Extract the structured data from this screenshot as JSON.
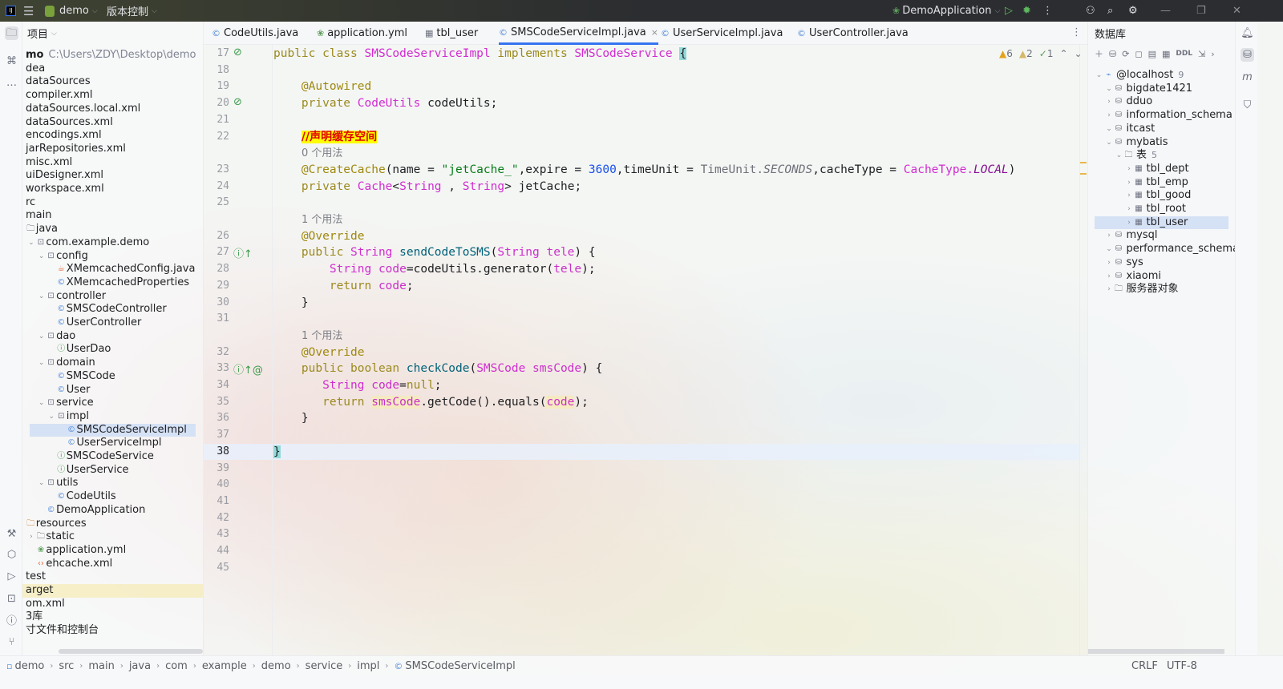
{
  "titlebar": {
    "project": "demo",
    "vcs": "版本控制",
    "run_config": "DemoApplication"
  },
  "project_panel": {
    "title": "项目",
    "items": [
      {
        "label": "mo",
        "level": 0,
        "path": "C:\\Users\\ZDY\\Desktop\\demo",
        "bold": true
      },
      {
        "label": "dea",
        "level": 0
      },
      {
        "label": "dataSources",
        "level": 0
      },
      {
        "label": "compiler.xml",
        "level": 0
      },
      {
        "label": "dataSources.local.xml",
        "level": 0
      },
      {
        "label": "dataSources.xml",
        "level": 0
      },
      {
        "label": "encodings.xml",
        "level": 0
      },
      {
        "label": "jarRepositories.xml",
        "level": 0
      },
      {
        "label": "misc.xml",
        "level": 0
      },
      {
        "label": "uiDesigner.xml",
        "level": 0
      },
      {
        "label": "workspace.xml",
        "level": 0
      },
      {
        "label": "rc",
        "level": 0
      },
      {
        "label": "main",
        "level": 0
      },
      {
        "label": "java",
        "level": 1,
        "icon": "folder"
      },
      {
        "label": "com.example.demo",
        "level": 2,
        "icon": "package",
        "open": true
      },
      {
        "label": "config",
        "level": 3,
        "icon": "package",
        "open": true
      },
      {
        "label": "XMemcachedConfig.java",
        "level": 4,
        "icon": "java-file"
      },
      {
        "label": "XMemcachedProperties",
        "level": 4,
        "icon": "class"
      },
      {
        "label": "controller",
        "level": 3,
        "icon": "package",
        "open": true
      },
      {
        "label": "SMSCodeController",
        "level": 4,
        "icon": "class"
      },
      {
        "label": "UserController",
        "level": 4,
        "icon": "class"
      },
      {
        "label": "dao",
        "level": 3,
        "icon": "package",
        "open": true
      },
      {
        "label": "UserDao",
        "level": 4,
        "icon": "interface"
      },
      {
        "label": "domain",
        "level": 3,
        "icon": "package",
        "open": true
      },
      {
        "label": "SMSCode",
        "level": 4,
        "icon": "class"
      },
      {
        "label": "User",
        "level": 4,
        "icon": "class"
      },
      {
        "label": "service",
        "level": 3,
        "icon": "package",
        "open": true
      },
      {
        "label": "impl",
        "level": 4,
        "icon": "package",
        "open": true
      },
      {
        "label": "SMSCodeServiceImpl",
        "level": 5,
        "icon": "class",
        "selected": true
      },
      {
        "label": "UserServiceImpl",
        "level": 5,
        "icon": "class"
      },
      {
        "label": "SMSCodeService",
        "level": 4,
        "icon": "interface"
      },
      {
        "label": "UserService",
        "level": 4,
        "icon": "interface"
      },
      {
        "label": "utils",
        "level": 3,
        "icon": "package",
        "open": true
      },
      {
        "label": "CodeUtils",
        "level": 4,
        "icon": "class"
      },
      {
        "label": "DemoApplication",
        "level": 3,
        "icon": "spring-class"
      },
      {
        "label": "resources",
        "level": 1,
        "icon": "resources-folder"
      },
      {
        "label": "static",
        "level": 2,
        "icon": "folder",
        "closed": true
      },
      {
        "label": "application.yml",
        "level": 2,
        "icon": "yml"
      },
      {
        "label": "ehcache.xml",
        "level": 2,
        "icon": "xml"
      },
      {
        "label": "test",
        "level": 0
      },
      {
        "label": "arget",
        "level": 0,
        "highlight": true
      },
      {
        "label": "om.xml",
        "level": 0
      },
      {
        "label": "3库",
        "level": 0
      },
      {
        "label": "寸文件和控制台",
        "level": 0
      }
    ]
  },
  "tabs": [
    {
      "label": "CodeUtils.java",
      "icon": "class"
    },
    {
      "label": "application.yml",
      "icon": "yml"
    },
    {
      "label": "tbl_user",
      "icon": "table"
    },
    {
      "label": "SMSCodeServiceImpl.java",
      "icon": "class",
      "active": true
    },
    {
      "label": "UserServiceImpl.java",
      "icon": "class"
    },
    {
      "label": "UserController.java",
      "icon": "class"
    }
  ],
  "inspections": {
    "warnings": "6",
    "weak_warnings": "2",
    "ok": "1"
  },
  "code_lines": [
    {
      "n": "17",
      "g": "⊘",
      "t": [
        [
          "public class ",
          "kw"
        ],
        [
          "SMSCodeServiceImpl ",
          "ty"
        ],
        [
          "implements ",
          "kw"
        ],
        [
          "SMSCodeService ",
          "ty"
        ],
        [
          "{",
          "br"
        ]
      ]
    },
    {
      "n": "18",
      "t": []
    },
    {
      "n": "19",
      "t": [
        [
          "    "
        ],
        [
          "@Autowired",
          "an"
        ]
      ]
    },
    {
      "n": "20",
      "g": "⊘",
      "t": [
        [
          "    "
        ],
        [
          "private ",
          "kw"
        ],
        [
          "CodeUtils ",
          "ty"
        ],
        [
          "codeUtils;"
        ]
      ]
    },
    {
      "n": "21",
      "t": []
    },
    {
      "n": "22",
      "t": [
        [
          "    "
        ],
        [
          "//声明缓存空间",
          "cm"
        ]
      ]
    },
    {
      "hint": "0 个用法"
    },
    {
      "n": "23",
      "t": [
        [
          "    "
        ],
        [
          "@CreateCache",
          "an"
        ],
        [
          "(name = "
        ],
        [
          "\"jetCache_\"",
          "st"
        ],
        [
          ",expire = "
        ],
        [
          "3600",
          "nu"
        ],
        [
          ",timeUnit = "
        ],
        [
          "TimeUnit.",
          "gr"
        ],
        [
          "SECONDS",
          "gi2"
        ],
        [
          ",cacheType = "
        ],
        [
          "CacheType.",
          "ty"
        ],
        [
          "LOCAL",
          "it"
        ],
        [
          ")"
        ]
      ]
    },
    {
      "n": "24",
      "t": [
        [
          "    "
        ],
        [
          "private ",
          "kw"
        ],
        [
          "Cache",
          "ty"
        ],
        [
          "<"
        ],
        [
          "String",
          "ty"
        ],
        [
          " , "
        ],
        [
          "String",
          "ty"
        ],
        [
          "> jetCache;"
        ]
      ]
    },
    {
      "n": "25",
      "t": []
    },
    {
      "hint": "1 个用法"
    },
    {
      "n": "26",
      "t": [
        [
          "    "
        ],
        [
          "@Override",
          "an"
        ]
      ]
    },
    {
      "n": "27",
      "g": "ⓘ↑",
      "t": [
        [
          "    "
        ],
        [
          "public ",
          "kw"
        ],
        [
          "String ",
          "ty"
        ],
        [
          "sendCodeToSMS",
          "fn"
        ],
        [
          "("
        ],
        [
          "String ",
          "ty"
        ],
        [
          "tele",
          "pm"
        ],
        [
          ") {"
        ]
      ]
    },
    {
      "n": "28",
      "t": [
        [
          "        "
        ],
        [
          "String ",
          "ty"
        ],
        [
          "code",
          "pm"
        ],
        [
          "=codeUtils.generator("
        ],
        [
          "tele",
          "pm"
        ],
        [
          ");"
        ]
      ]
    },
    {
      "n": "29",
      "t": [
        [
          "        "
        ],
        [
          "return ",
          "kw"
        ],
        [
          "code",
          "pm"
        ],
        [
          ";"
        ]
      ]
    },
    {
      "n": "30",
      "t": [
        [
          "    }"
        ]
      ]
    },
    {
      "n": "31",
      "t": []
    },
    {
      "hint": "1 个用法"
    },
    {
      "n": "32",
      "t": [
        [
          "    "
        ],
        [
          "@Override",
          "an"
        ]
      ]
    },
    {
      "n": "33",
      "g": "ⓘ↑@",
      "t": [
        [
          "    "
        ],
        [
          "public ",
          "kw"
        ],
        [
          "boolean ",
          "kw"
        ],
        [
          "checkCode",
          "fn"
        ],
        [
          "("
        ],
        [
          "SMSCode ",
          "ty"
        ],
        [
          "smsCode",
          "pm"
        ],
        [
          ") {"
        ]
      ]
    },
    {
      "n": "34",
      "t": [
        [
          "       "
        ],
        [
          "String ",
          "ty"
        ],
        [
          "code",
          "pm"
        ],
        [
          "="
        ],
        [
          "null",
          "kw"
        ],
        [
          ";"
        ]
      ]
    },
    {
      "n": "35",
      "t": [
        [
          "       "
        ],
        [
          "return ",
          "kw"
        ],
        [
          "smsCode",
          "hlpm"
        ],
        [
          ".getCode().equals("
        ],
        [
          "code",
          "hlpm"
        ],
        [
          ");"
        ]
      ]
    },
    {
      "n": "36",
      "t": [
        [
          "    }"
        ]
      ]
    },
    {
      "n": "37",
      "t": []
    },
    {
      "n": "38",
      "t": [
        [
          "}",
          "br"
        ]
      ],
      "current": true
    },
    {
      "n": "39",
      "t": []
    },
    {
      "n": "40",
      "t": []
    },
    {
      "n": "41",
      "t": []
    },
    {
      "n": "42",
      "t": []
    },
    {
      "n": "43",
      "t": []
    },
    {
      "n": "44",
      "t": []
    },
    {
      "n": "45",
      "t": []
    }
  ],
  "database": {
    "title": "数据库",
    "toolbar_ddl": "DDL",
    "items": [
      {
        "label": "@localhost",
        "level": 0,
        "count": "9",
        "icon": "host",
        "open": true
      },
      {
        "label": "bigdate1421",
        "level": 1,
        "icon": "schema",
        "open": true
      },
      {
        "label": "dduo",
        "level": 1,
        "icon": "schema"
      },
      {
        "label": "information_schema",
        "level": 1,
        "icon": "schema"
      },
      {
        "label": "itcast",
        "level": 1,
        "icon": "schema",
        "open": true
      },
      {
        "label": "mybatis",
        "level": 1,
        "icon": "schema",
        "open": true
      },
      {
        "label": "表",
        "level": 2,
        "count": "5",
        "icon": "folder",
        "open": true
      },
      {
        "label": "tbl_dept",
        "level": 3,
        "icon": "table"
      },
      {
        "label": "tbl_emp",
        "level": 3,
        "icon": "table"
      },
      {
        "label": "tbl_good",
        "level": 3,
        "icon": "table"
      },
      {
        "label": "tbl_root",
        "level": 3,
        "icon": "table"
      },
      {
        "label": "tbl_user",
        "level": 3,
        "icon": "table",
        "selected": true
      },
      {
        "label": "mysql",
        "level": 1,
        "icon": "schema"
      },
      {
        "label": "performance_schema",
        "level": 1,
        "icon": "schema",
        "open": true
      },
      {
        "label": "sys",
        "level": 1,
        "icon": "schema"
      },
      {
        "label": "xiaomi",
        "level": 1,
        "icon": "schema"
      },
      {
        "label": "服务器对象",
        "level": 1,
        "icon": "folder"
      }
    ]
  },
  "status": {
    "breadcrumb": [
      "demo",
      "src",
      "main",
      "java",
      "com",
      "example",
      "demo",
      "service",
      "impl",
      "SMSCodeServiceImpl"
    ],
    "line_sep": "CRLF",
    "encoding": "UTF-8"
  },
  "colors": {
    "accent": "#3574f0",
    "selection": "#d5e1f5",
    "keyword": "#9b8a1f",
    "type": "#d02cd0",
    "string": "#067d17",
    "number": "#1750eb"
  }
}
